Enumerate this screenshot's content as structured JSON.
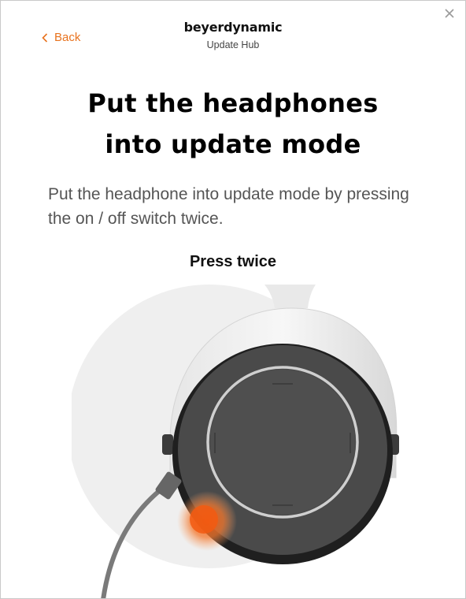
{
  "header": {
    "back_label": "Back",
    "brand": "beyerdynamic",
    "app_name": "Update Hub"
  },
  "main": {
    "title_line1": "Put the headphones",
    "title_line2": "into update mode",
    "description": "Put the headphone into update mode by pressing the on / off switch twice.",
    "instruction_label": "Press twice"
  },
  "colors": {
    "accent": "#e8731f",
    "ring_highlight": "#f06a1c"
  },
  "icons": {
    "back": "chevron-left-icon",
    "close": "close-icon"
  }
}
